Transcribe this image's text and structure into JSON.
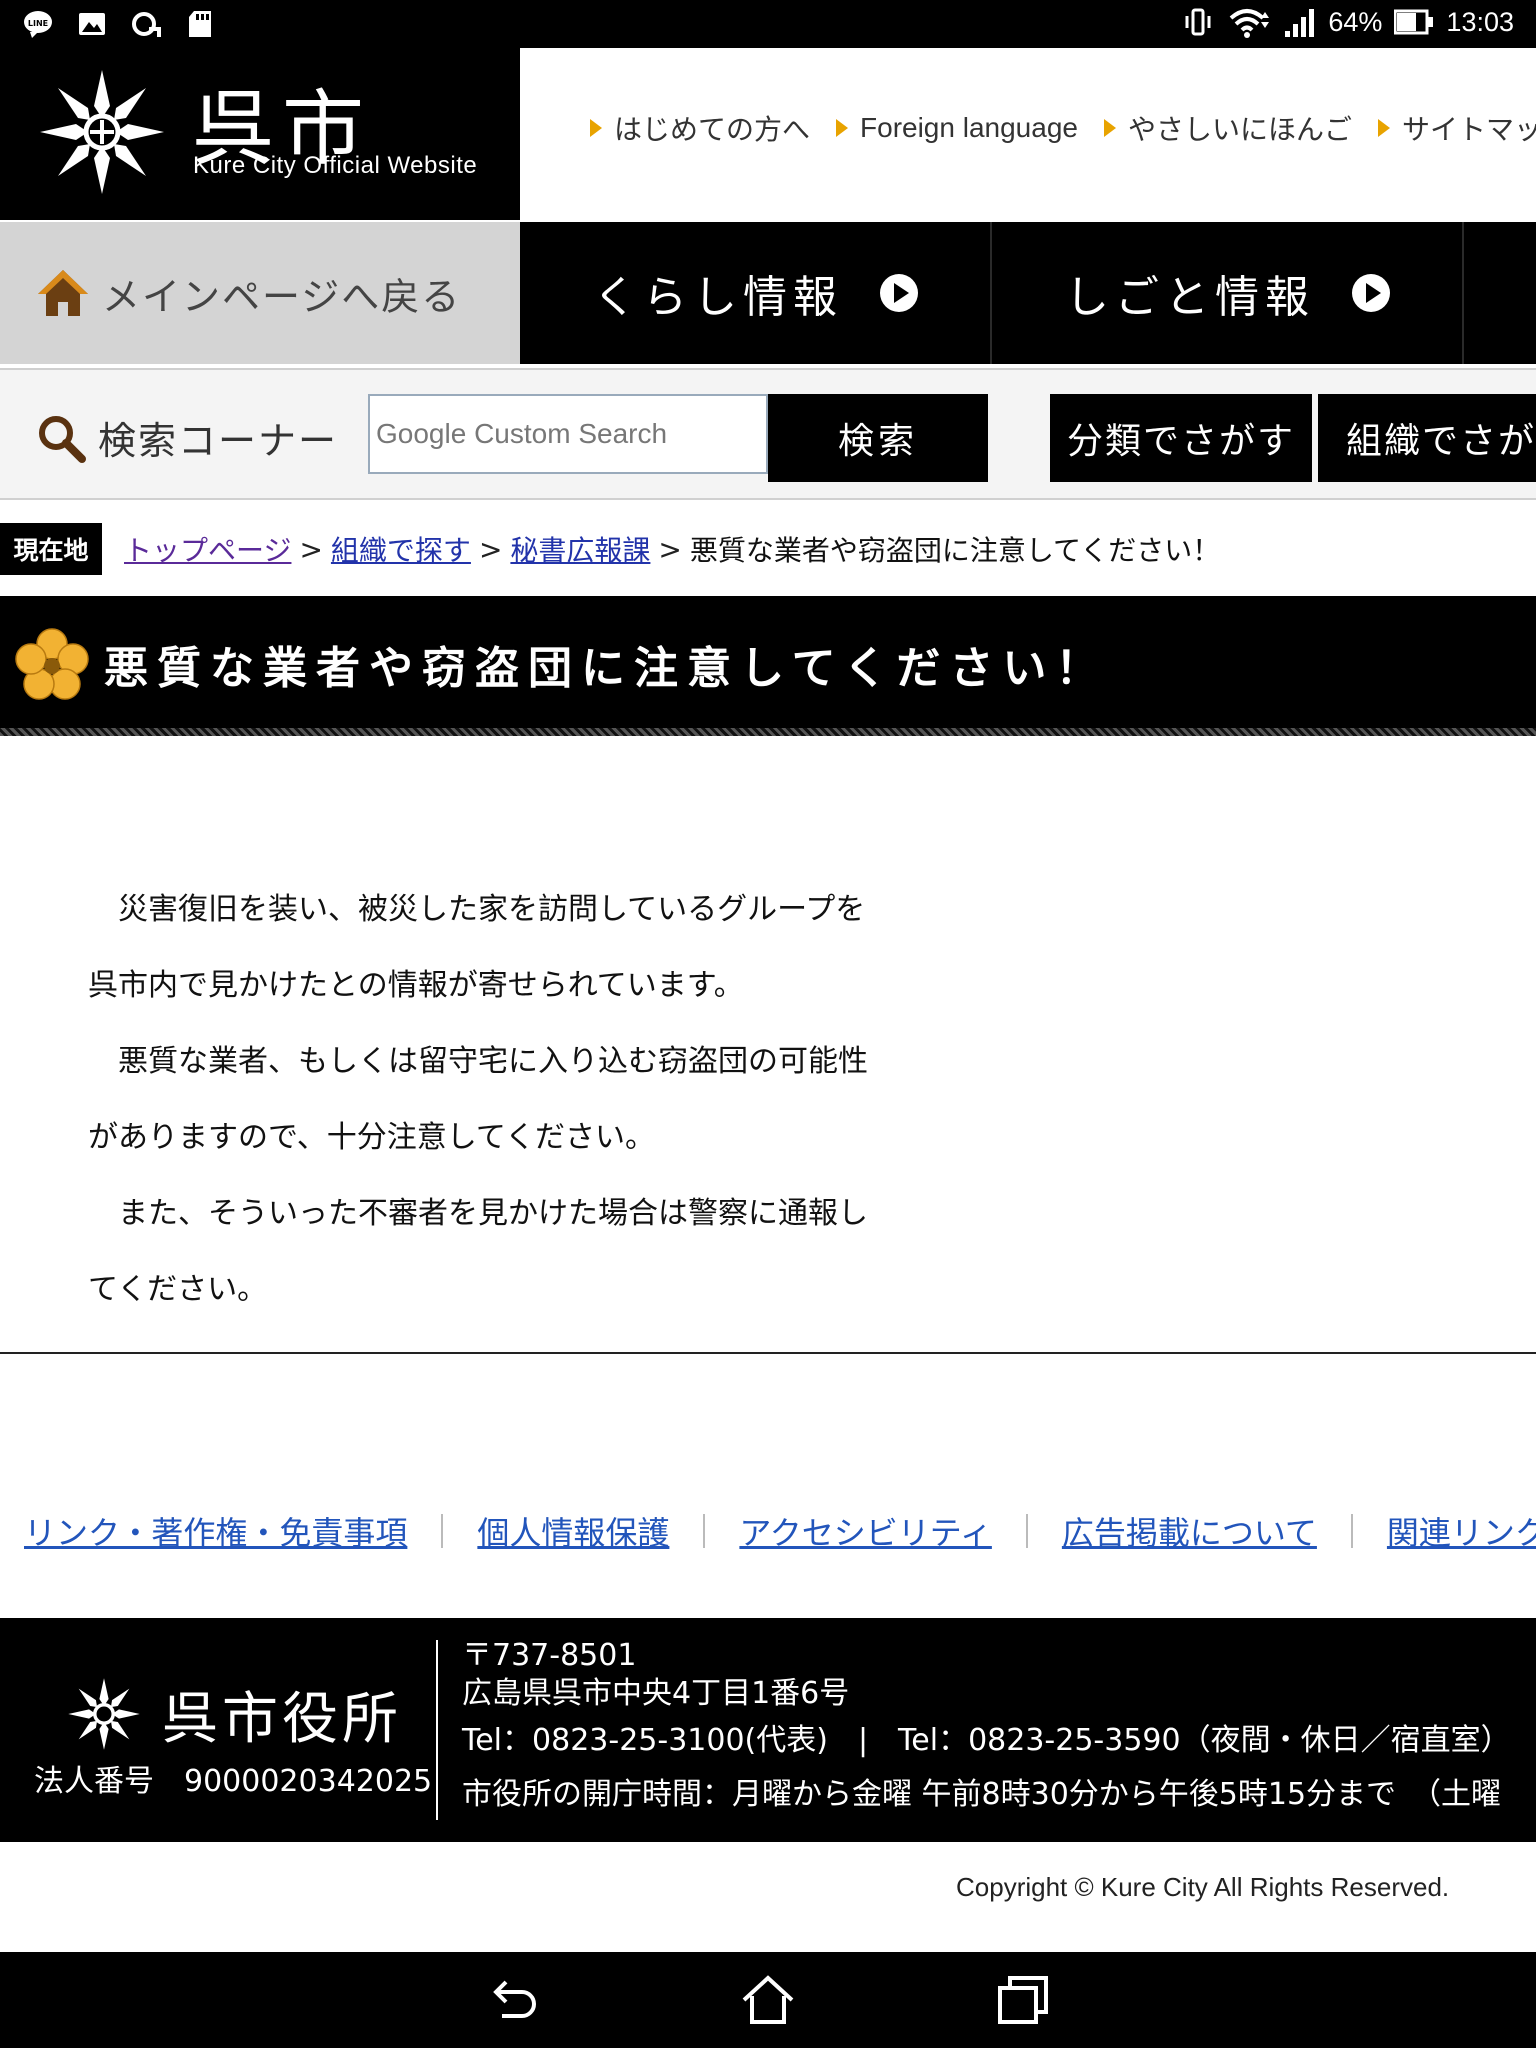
{
  "status_bar": {
    "battery": "64%",
    "time": "13:03",
    "left_icons": [
      "line-icon",
      "gallery-icon",
      "sync-icon",
      "sd-card-icon"
    ],
    "right_icons": [
      "vibrate-icon",
      "wifi-icon",
      "signal-icon",
      "battery-icon"
    ]
  },
  "header": {
    "logo_title": "呉市",
    "logo_subtitle": "Kure City Official Website",
    "top_links": [
      {
        "label": "はじめての方へ"
      },
      {
        "label": "Foreign language"
      },
      {
        "label": "やさしいにほんご"
      },
      {
        "label": "サイトマップ"
      }
    ]
  },
  "main_nav": {
    "home_label": "メインページへ戻る",
    "items": [
      {
        "label": "くらし情報"
      },
      {
        "label": "しごと情報"
      }
    ]
  },
  "search": {
    "label": "検索コーナー",
    "placeholder": "Google Custom Search",
    "button_label": "検索",
    "category_buttons": [
      {
        "label": "分類でさがす"
      },
      {
        "label": "組織でさがす"
      }
    ]
  },
  "breadcrumb": {
    "badge": "現在地",
    "items": [
      {
        "label": "トップページ"
      },
      {
        "label": "組織で探す"
      },
      {
        "label": "秘書広報課"
      }
    ],
    "current": "悪質な業者や窃盗団に注意してください！",
    "separator": ">"
  },
  "page": {
    "title": "悪質な業者や窃盗団に注意してください！",
    "lines": [
      "　災害復旧を装い、被災した家を訪問しているグループを",
      "呉市内で見かけたとの情報が寄せられています。",
      "　悪質な業者、もしくは留守宅に入り込む窃盗団の可能性",
      "がありますので、十分注意してください。",
      "　また、そういった不審者を見かけた場合は警察に通報し",
      "てください。"
    ]
  },
  "footer_links": [
    {
      "label": "リンク・著作権・免責事項"
    },
    {
      "label": "個人情報保護"
    },
    {
      "label": "アクセシビリティ"
    },
    {
      "label": "広告掲載について"
    },
    {
      "label": "関連リンク"
    }
  ],
  "footer": {
    "office_name": "呉市役所",
    "corp_number": "法人番号　9000020342025",
    "postal": "〒737-8501",
    "address": "広島県呉市中央4丁目1番6号",
    "tel": "Tel：0823-25-3100(代表)　|　Tel：0823-25-3590（夜間・休日／宿直室）",
    "hours": "市役所の開庁時間：月曜から金曜 午前8時30分から午後5時15分まで　（土曜"
  },
  "copyright": "Copyright © Kure City All Rights Reserved.",
  "colors": {
    "accent_orange": "#e8a300",
    "link_blue": "#2233aa",
    "visited_purple": "#5a2a99",
    "header_black": "#000000"
  }
}
